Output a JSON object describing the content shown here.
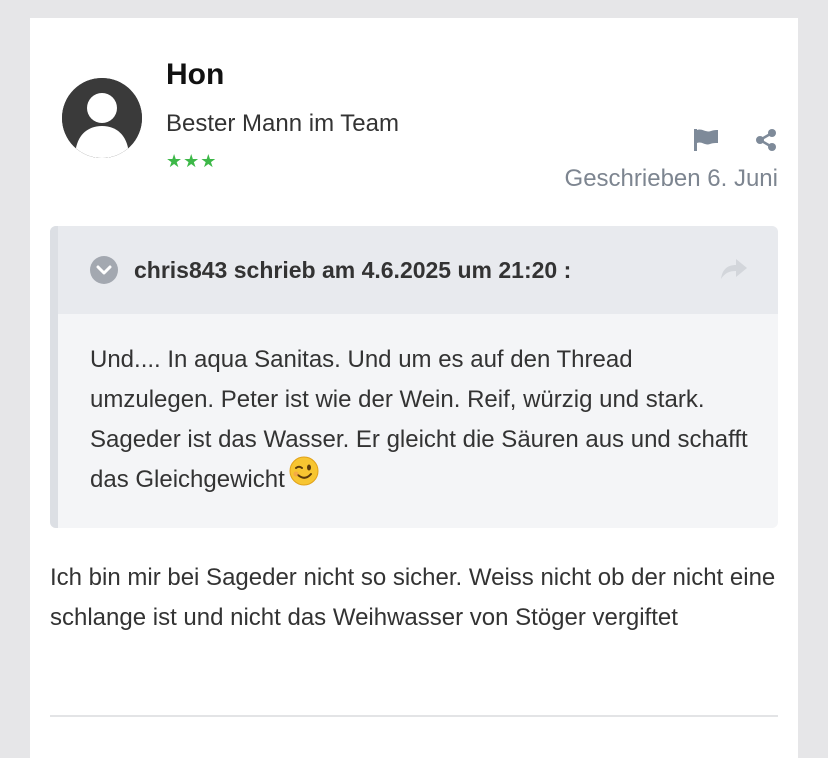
{
  "post": {
    "author": {
      "name": "Hon",
      "title": "Bester Mann im Team",
      "rank": "★★★",
      "avatar_icon": "default-user-avatar"
    },
    "actions": [
      {
        "icon": "flag-icon"
      },
      {
        "icon": "share-icon"
      }
    ],
    "date": "Geschrieben 6. Juni",
    "quote": {
      "citation": "chris843 schrieb am 4.6.2025 um 21:20 :",
      "toggle_icon": "chevron-down-icon",
      "jump_icon": "forward-arrow-icon",
      "text": "Und.... In aqua Sanitas. Und um es auf den Thread umzulegen. Peter ist wie der Wein. Reif, würzig und stark. Sageder ist das Wasser. Er gleicht die Säuren aus und schafft das Gleichgewicht",
      "emoji": "winking-face-emoji"
    },
    "body": "Ich bin mir bei Sageder nicht so sicher. Weiss nicht ob der nicht eine schlange ist und nicht das Weihwasser von Stöger vergiftet"
  },
  "colors": {
    "page_bg": "#e6e6e8",
    "card_bg": "#ffffff",
    "date_text": "#7d8590",
    "rank_stars": "#3db848",
    "quote_bg": "#f4f5f7",
    "quote_header_bg": "#e8eaee"
  }
}
